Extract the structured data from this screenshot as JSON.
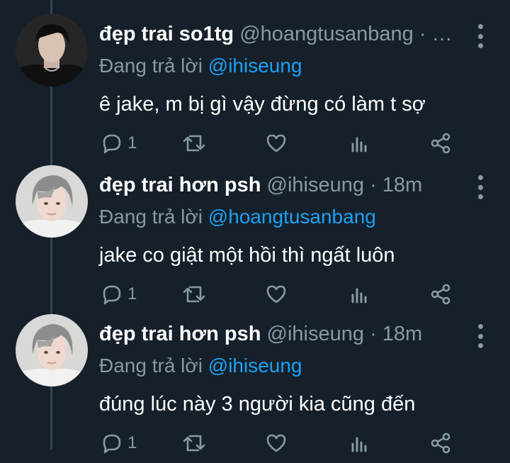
{
  "tweets": [
    {
      "name": "đẹp trai so1tg",
      "handle": "@hoangtusanbang",
      "separator": "·",
      "time": "…",
      "reply_prefix": "Đang trả lời",
      "reply_to": "@ihiseung",
      "text": "ê jake, m bị gì vậy đừng có làm t sợ",
      "reply_count": "1",
      "avatar": "profile-photo"
    },
    {
      "name": "đẹp trai hơn psh",
      "handle": "@ihiseung",
      "separator": "·",
      "time": "18m",
      "reply_prefix": "Đang trả lời",
      "reply_to": "@hoangtusanbang",
      "text": "jake co giật một hồi thì ngất luôn",
      "reply_count": "1",
      "avatar": "profile-photo"
    },
    {
      "name": "đẹp trai hơn psh",
      "handle": "@ihiseung",
      "separator": "·",
      "time": "18m",
      "reply_prefix": "Đang trả lời",
      "reply_to": "@ihiseung",
      "text": "đúng lúc này 3 người kia cũng đến",
      "reply_count": "1",
      "avatar": "profile-photo"
    }
  ],
  "icons": [
    "reply-icon",
    "retweet-icon",
    "like-icon",
    "analytics-icon",
    "share-icon",
    "more-icon"
  ],
  "colors": {
    "background": "#15202b",
    "name": "#ffffff",
    "secondary": "#8899a6",
    "link": "#1da1f2",
    "thread_line": "#38444d"
  }
}
